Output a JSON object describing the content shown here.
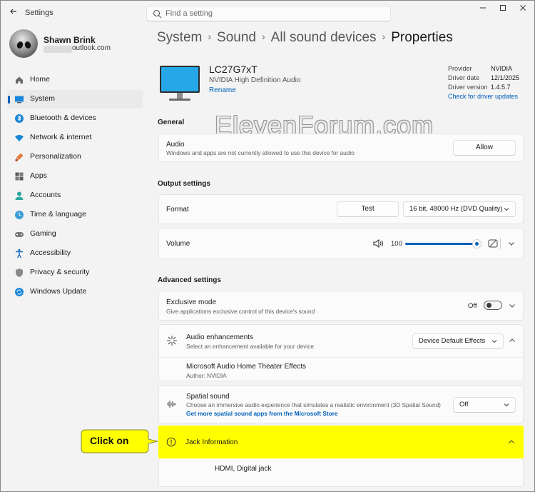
{
  "window": {
    "title": "Settings"
  },
  "search": {
    "placeholder": "Find a setting"
  },
  "profile": {
    "name": "Shawn Brink",
    "email": "outlook.com"
  },
  "nav": [
    {
      "label": "Home",
      "icon": "home-icon"
    },
    {
      "label": "System",
      "icon": "system-icon",
      "active": true
    },
    {
      "label": "Bluetooth & devices",
      "icon": "bluetooth-icon"
    },
    {
      "label": "Network & internet",
      "icon": "network-icon"
    },
    {
      "label": "Personalization",
      "icon": "brush-icon"
    },
    {
      "label": "Apps",
      "icon": "apps-icon"
    },
    {
      "label": "Accounts",
      "icon": "accounts-icon"
    },
    {
      "label": "Time & language",
      "icon": "time-language-icon"
    },
    {
      "label": "Gaming",
      "icon": "gaming-icon"
    },
    {
      "label": "Accessibility",
      "icon": "accessibility-icon"
    },
    {
      "label": "Privacy & security",
      "icon": "shield-icon"
    },
    {
      "label": "Windows Update",
      "icon": "update-icon"
    }
  ],
  "breadcrumb": [
    "System",
    "Sound",
    "All sound devices",
    "Properties"
  ],
  "device": {
    "name": "LC27G7xT",
    "subtitle": "NVIDIA High Definition Audio",
    "rename": "Rename",
    "driver": {
      "provider_label": "Provider",
      "provider": "NVIDIA",
      "date_label": "Driver date",
      "date": "12/1/2025",
      "version_label": "Driver version",
      "version": "1.4.5.7",
      "link": "Check for driver updates"
    }
  },
  "watermark": "ElevenForum.com",
  "general": {
    "title": "General",
    "audio": {
      "title": "Audio",
      "desc": "Windows and apps are not currently allowed to use this device for audio",
      "button": "Allow"
    }
  },
  "output": {
    "title": "Output settings",
    "format": {
      "title": "Format",
      "test": "Test",
      "value": "16 bit, 48000 Hz (DVD Quality)"
    },
    "volume": {
      "title": "Volume",
      "value": "100",
      "level": 1.0
    }
  },
  "advanced": {
    "title": "Advanced settings",
    "exclusive": {
      "title": "Exclusive mode",
      "desc": "Give applications exclusive control of this device's sound",
      "state": "Off"
    },
    "enhancements": {
      "title": "Audio enhancements",
      "desc": "Select an enhancement available for your device",
      "value": "Device Default Effects"
    },
    "effect": {
      "title": "Microsoft Audio Home Theater Effects",
      "author": "Author: NVIDIA"
    },
    "spatial": {
      "title": "Spatial sound",
      "desc": "Choose an immersive audio experience that simulates a realistic environment (3D Spatial Sound)",
      "link": "Get more spatial sound apps from the Microsoft Store",
      "value": "Off"
    },
    "jack": {
      "title": "Jack Information",
      "value": "HDMI, Digital jack"
    }
  },
  "callout": {
    "text": "Click on"
  },
  "colors": {
    "accent": "#005fb8",
    "highlight": "#ffff00"
  }
}
